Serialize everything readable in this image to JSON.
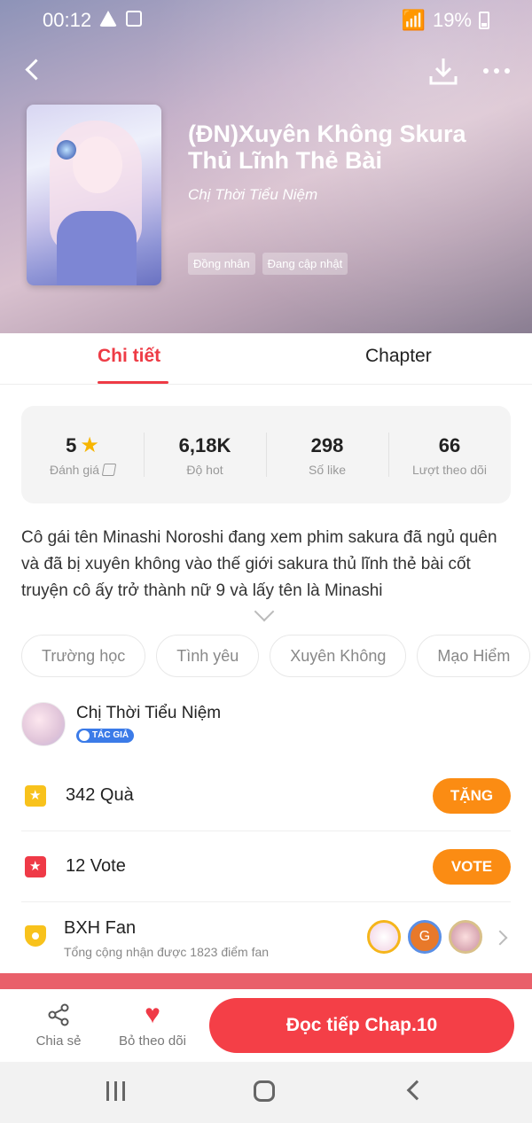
{
  "status_bar": {
    "time": "00:12",
    "battery": "19%"
  },
  "book": {
    "title": "(ĐN)Xuyên Không Skura Thủ Lĩnh Thẻ Bài",
    "author": "Chị Thời Tiểu Niệm",
    "tags": [
      "Đồng nhân",
      "Đang cập nhật"
    ]
  },
  "tabs": {
    "detail": "Chi tiết",
    "chapter": "Chapter"
  },
  "stats": {
    "rating": {
      "value": "5",
      "label": "Đánh giá"
    },
    "hot": {
      "value": "6,18K",
      "label": "Độ hot"
    },
    "likes": {
      "value": "298",
      "label": "Số like"
    },
    "follows": {
      "value": "66",
      "label": "Lượt theo dõi"
    }
  },
  "description": "Cô gái tên Minashi Noroshi  đang xem phim sakura đã ngủ quên và đã bị xuyên không vào thế giới sakura thủ lĩnh thẻ bài cốt truyện cô ấy trở thành nữ 9 và lấy tên là Minashi",
  "genres": [
    "Trường học",
    "Tình yêu",
    "Xuyên Không",
    "Mạo Hiểm"
  ],
  "author_row": {
    "name": "Chị Thời Tiểu Niệm",
    "badge": "TÁC GIẢ"
  },
  "gift": {
    "text": "342  Quà",
    "button": "TẶNG"
  },
  "vote": {
    "text": "12  Vote",
    "button": "VOTE"
  },
  "fan": {
    "title": "BXH Fan",
    "subtitle": "Tổng cộng nhận được 1823 điểm fan",
    "avatar_letter": "G"
  },
  "bottom_bar": {
    "share": "Chia sẻ",
    "unfollow": "Bỏ theo dõi",
    "read": "Đọc tiếp Chap.10"
  },
  "colors": {
    "accent": "#ee3b45",
    "orange": "#fb8c13",
    "read_button": "#f43f47"
  }
}
